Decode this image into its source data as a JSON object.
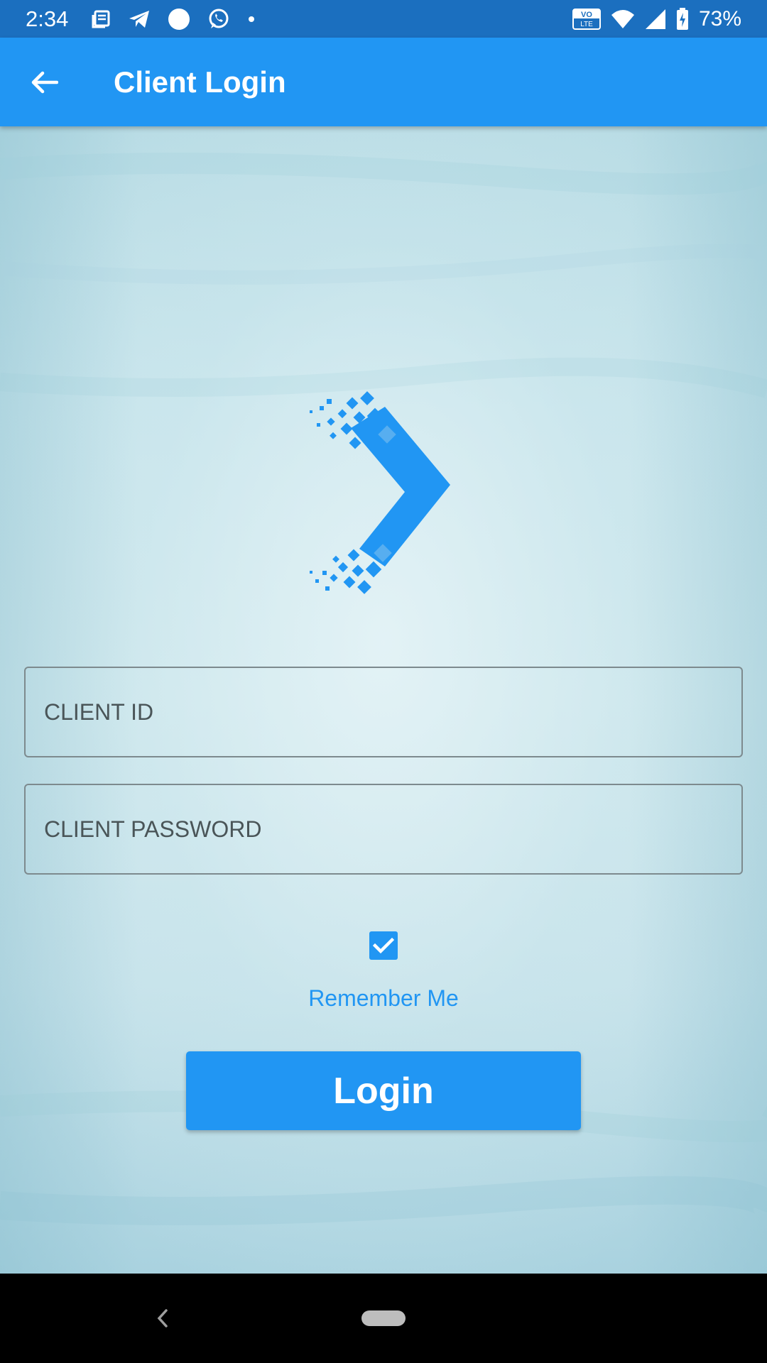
{
  "status_bar": {
    "time": "2:34",
    "battery": "73%",
    "icons_left": [
      "news-icon",
      "telegram-icon",
      "circle-icon",
      "whatsapp-icon",
      "dot-icon"
    ],
    "icons_right": [
      "volte-icon",
      "wifi-icon",
      "signal-icon",
      "battery-charging-icon"
    ],
    "volte_line1": "VO",
    "volte_line2": "LTE"
  },
  "app_bar": {
    "title": "Client Login",
    "back_icon": "arrow-left-icon"
  },
  "form": {
    "client_id_placeholder": "CLIENT ID",
    "client_id_value": "",
    "client_password_placeholder": "CLIENT PASSWORD",
    "client_password_value": "",
    "remember_checked": true,
    "remember_label": "Remember Me",
    "login_label": "Login"
  },
  "colors": {
    "primary": "#2196f3",
    "status_bar": "#1b6fbf"
  }
}
